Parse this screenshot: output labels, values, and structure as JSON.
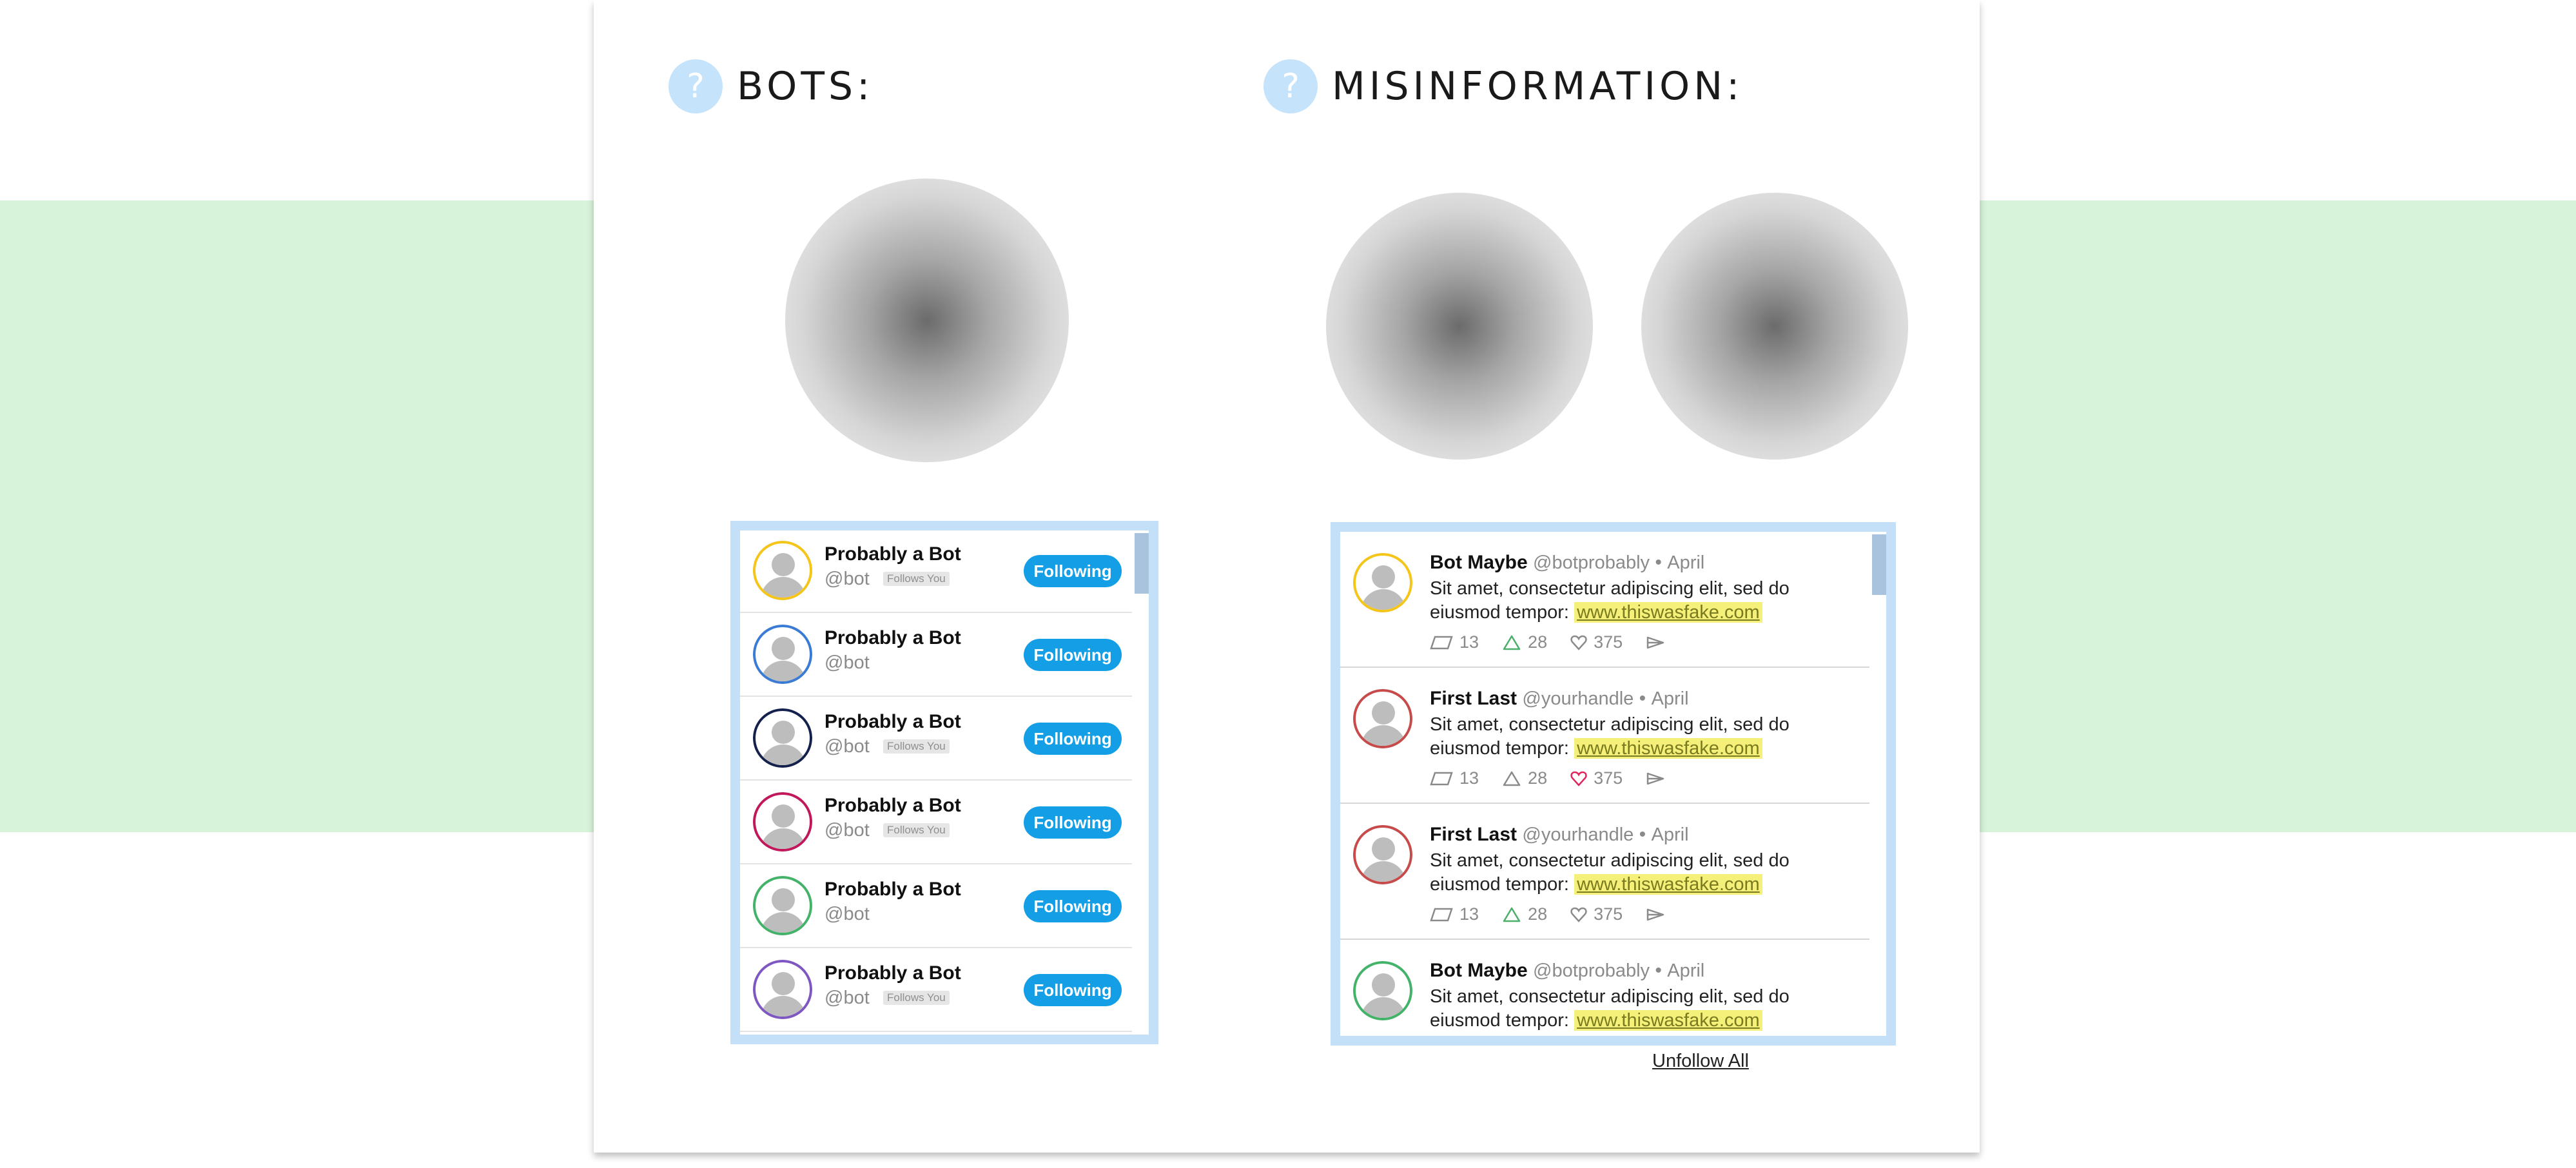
{
  "colors": {
    "band": "#d7f4da",
    "panel_border": "#c3e0f8",
    "follow_button": "#149ee5",
    "link_highlight": "#f5f07a",
    "liked_heart": "#e0245e",
    "retweet": "#4caf6a"
  },
  "bots_section": {
    "title": "BOTS:",
    "help_icon": "?",
    "unfollow_all": "Unfollow All",
    "rows": [
      {
        "name": "Probably a Bot",
        "handle": "@bot",
        "follows_you": "Follows You",
        "button": "Following",
        "ring": "#f5c518"
      },
      {
        "name": "Probably a Bot",
        "handle": "@bot",
        "follows_you": "",
        "button": "Following",
        "ring": "#3a7bd5"
      },
      {
        "name": "Probably a Bot",
        "handle": "@bot",
        "follows_you": "Follows You",
        "button": "Following",
        "ring": "#14214d"
      },
      {
        "name": "Probably a Bot",
        "handle": "@bot",
        "follows_you": "Follows You",
        "button": "Following",
        "ring": "#c2185b"
      },
      {
        "name": "Probably a Bot",
        "handle": "@bot",
        "follows_you": "",
        "button": "Following",
        "ring": "#43b36a"
      },
      {
        "name": "Probably a Bot",
        "handle": "@bot",
        "follows_you": "Follows You",
        "button": "Following",
        "ring": "#7e57c2"
      }
    ]
  },
  "misinfo_section": {
    "title": "MISINFORMATION:",
    "help_icon": "?",
    "tweets": [
      {
        "name": "Bot Maybe",
        "handle": "@botprobably",
        "dot": "•",
        "date": "April",
        "text": "Sit amet, consectetur adipiscing elit, sed do eiusmod tempor:",
        "link": "www.thiswasfake.com",
        "replies": "13",
        "retweets": "28",
        "likes": "375",
        "ring": "#f5c518",
        "liked": false
      },
      {
        "name": "First Last",
        "handle": "@yourhandle",
        "dot": "•",
        "date": "April",
        "text": "Sit amet, consectetur adipiscing elit, sed do eiusmod tempor:",
        "link": "www.thiswasfake.com",
        "replies": "13",
        "retweets": "28",
        "likes": "375",
        "ring": "#c84b4b",
        "liked": true
      },
      {
        "name": "First Last",
        "handle": "@yourhandle",
        "dot": "•",
        "date": "April",
        "text": "Sit amet, consectetur adipiscing elit, sed do eiusmod tempor:",
        "link": "www.thiswasfake.com",
        "replies": "13",
        "retweets": "28",
        "likes": "375",
        "ring": "#c84b4b",
        "liked": false
      },
      {
        "name": "Bot Maybe",
        "handle": "@botprobably",
        "dot": "•",
        "date": "April",
        "text": "Sit amet, consectetur adipiscing elit, sed do eiusmod tempor:",
        "link": "www.thiswasfake.com",
        "replies": "",
        "retweets": "",
        "likes": "",
        "ring": "#43b36a",
        "liked": false
      }
    ]
  }
}
